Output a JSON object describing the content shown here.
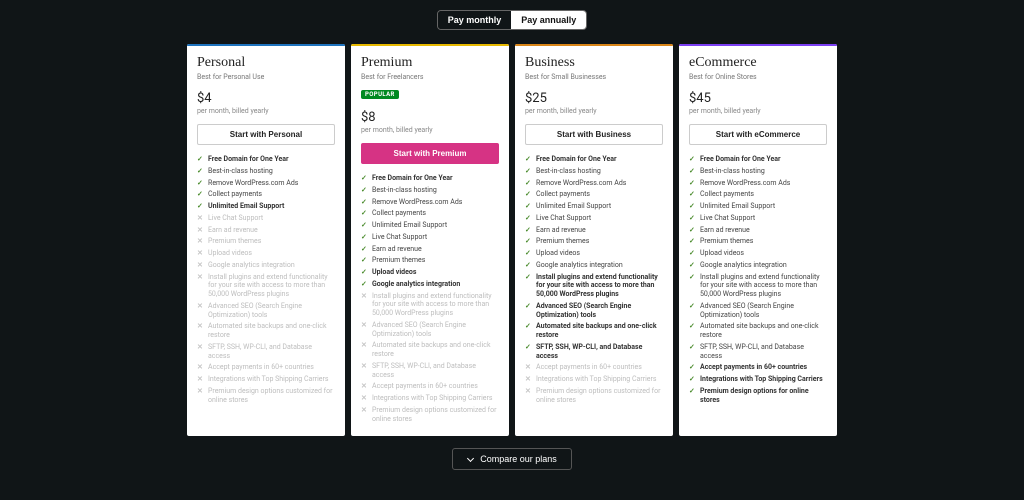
{
  "billing": {
    "monthly": "Pay monthly",
    "annually": "Pay annually"
  },
  "compare": "Compare our plans",
  "accent": {
    "personal": "#1e73be",
    "premium": "#e6b800",
    "business": "#d98518",
    "ecommerce": "#7b3ff2",
    "cta": "#d63384"
  },
  "plans": [
    {
      "id": "personal",
      "title": "Personal",
      "subtitle": "Best for Personal Use",
      "price": "$4",
      "price_sub": "per month, billed yearly",
      "cta": "Start with Personal",
      "popular": false,
      "primary_cta": false,
      "features": [
        {
          "t": "Free Domain for One Year",
          "in": true,
          "b": true
        },
        {
          "t": "Best-in-class hosting",
          "in": true
        },
        {
          "t": "Remove WordPress.com Ads",
          "in": true
        },
        {
          "t": "Collect payments",
          "in": true
        },
        {
          "t": "Unlimited Email Support",
          "in": true,
          "b": true
        },
        {
          "t": "Live Chat Support",
          "in": false
        },
        {
          "t": "Earn ad revenue",
          "in": false
        },
        {
          "t": "Premium themes",
          "in": false
        },
        {
          "t": "Upload videos",
          "in": false
        },
        {
          "t": "Google analytics integration",
          "in": false
        },
        {
          "t": "Install plugins and extend functionality for your site with access to more than 50,000 WordPress plugins",
          "in": false
        },
        {
          "t": "Advanced SEO (Search Engine Optimization) tools",
          "in": false
        },
        {
          "t": "Automated site backups and one-click restore",
          "in": false
        },
        {
          "t": "SFTP, SSH, WP-CLI, and Database access",
          "in": false
        },
        {
          "t": "Accept payments in 60+ countries",
          "in": false
        },
        {
          "t": "Integrations with Top Shipping Carriers",
          "in": false
        },
        {
          "t": "Premium design options customized for online stores",
          "in": false
        }
      ]
    },
    {
      "id": "premium",
      "title": "Premium",
      "subtitle": "Best for Freelancers",
      "price": "$8",
      "price_sub": "per month, billed yearly",
      "cta": "Start with Premium",
      "popular": true,
      "popular_label": "POPULAR",
      "primary_cta": true,
      "features": [
        {
          "t": "Free Domain for One Year",
          "in": true,
          "b": true
        },
        {
          "t": "Best-in-class hosting",
          "in": true
        },
        {
          "t": "Remove WordPress.com Ads",
          "in": true
        },
        {
          "t": "Collect payments",
          "in": true
        },
        {
          "t": "Unlimited Email Support",
          "in": true
        },
        {
          "t": "Live Chat Support",
          "in": true
        },
        {
          "t": "Earn ad revenue",
          "in": true
        },
        {
          "t": "Premium themes",
          "in": true
        },
        {
          "t": "Upload videos",
          "in": true,
          "b": true
        },
        {
          "t": "Google analytics integration",
          "in": true,
          "b": true
        },
        {
          "t": "Install plugins and extend functionality for your site with access to more than 50,000 WordPress plugins",
          "in": false
        },
        {
          "t": "Advanced SEO (Search Engine Optimization) tools",
          "in": false
        },
        {
          "t": "Automated site backups and one-click restore",
          "in": false
        },
        {
          "t": "SFTP, SSH, WP-CLI, and Database access",
          "in": false
        },
        {
          "t": "Accept payments in 60+ countries",
          "in": false
        },
        {
          "t": "Integrations with Top Shipping Carriers",
          "in": false
        },
        {
          "t": "Premium design options customized for online stores",
          "in": false
        }
      ]
    },
    {
      "id": "business",
      "title": "Business",
      "subtitle": "Best for Small Businesses",
      "price": "$25",
      "price_sub": "per month, billed yearly",
      "cta": "Start with Business",
      "popular": false,
      "primary_cta": false,
      "features": [
        {
          "t": "Free Domain for One Year",
          "in": true,
          "b": true
        },
        {
          "t": "Best-in-class hosting",
          "in": true
        },
        {
          "t": "Remove WordPress.com Ads",
          "in": true
        },
        {
          "t": "Collect payments",
          "in": true
        },
        {
          "t": "Unlimited Email Support",
          "in": true
        },
        {
          "t": "Live Chat Support",
          "in": true
        },
        {
          "t": "Earn ad revenue",
          "in": true
        },
        {
          "t": "Premium themes",
          "in": true
        },
        {
          "t": "Upload videos",
          "in": true
        },
        {
          "t": "Google analytics integration",
          "in": true
        },
        {
          "t": "Install plugins and extend functionality for your site with access to more than 50,000 WordPress plugins",
          "in": true,
          "b": true
        },
        {
          "t": "Advanced SEO (Search Engine Optimization) tools",
          "in": true,
          "b": true
        },
        {
          "t": "Automated site backups and one-click restore",
          "in": true,
          "b": true
        },
        {
          "t": "SFTP, SSH, WP-CLI, and Database access",
          "in": true,
          "b": true
        },
        {
          "t": "Accept payments in 60+ countries",
          "in": false
        },
        {
          "t": "Integrations with Top Shipping Carriers",
          "in": false
        },
        {
          "t": "Premium design options customized for online stores",
          "in": false
        }
      ]
    },
    {
      "id": "ecommerce",
      "title": "eCommerce",
      "subtitle": "Best for Online Stores",
      "price": "$45",
      "price_sub": "per month, billed yearly",
      "cta": "Start with eCommerce",
      "popular": false,
      "primary_cta": false,
      "features": [
        {
          "t": "Free Domain for One Year",
          "in": true,
          "b": true
        },
        {
          "t": "Best-in-class hosting",
          "in": true
        },
        {
          "t": "Remove WordPress.com Ads",
          "in": true
        },
        {
          "t": "Collect payments",
          "in": true
        },
        {
          "t": "Unlimited Email Support",
          "in": true
        },
        {
          "t": "Live Chat Support",
          "in": true
        },
        {
          "t": "Earn ad revenue",
          "in": true
        },
        {
          "t": "Premium themes",
          "in": true
        },
        {
          "t": "Upload videos",
          "in": true
        },
        {
          "t": "Google analytics integration",
          "in": true
        },
        {
          "t": "Install plugins and extend functionality for your site with access to more than 50,000 WordPress plugins",
          "in": true
        },
        {
          "t": "Advanced SEO (Search Engine Optimization) tools",
          "in": true
        },
        {
          "t": "Automated site backups and one-click restore",
          "in": true
        },
        {
          "t": "SFTP, SSH, WP-CLI, and Database access",
          "in": true
        },
        {
          "t": "Accept payments in 60+ countries",
          "in": true,
          "b": true
        },
        {
          "t": "Integrations with Top Shipping Carriers",
          "in": true,
          "b": true
        },
        {
          "t": "Premium design options for online stores",
          "in": true,
          "b": true
        }
      ]
    }
  ]
}
